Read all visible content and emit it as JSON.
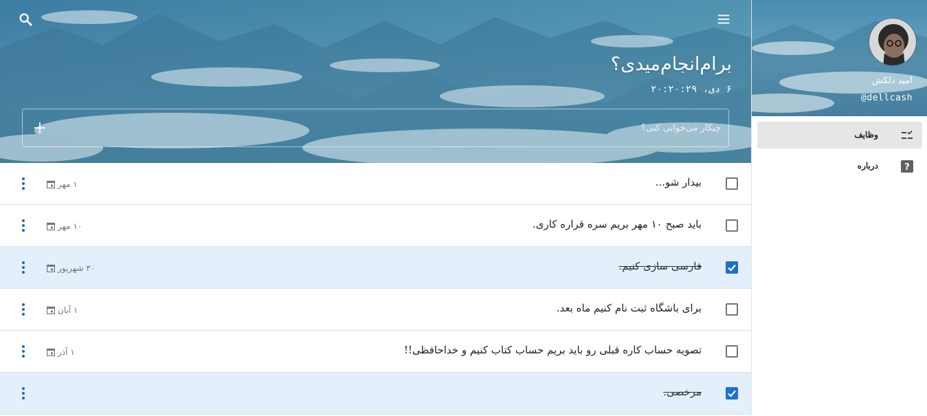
{
  "header": {
    "title": "برام‌انجام‌میدی؟",
    "datetime": "۶ دی، ۲۰:۲۰:۲۹",
    "search_icon": "search-icon",
    "menu_icon": "menu-icon"
  },
  "new_task": {
    "placeholder": "چیکار می‌خوایی کنی؟",
    "add_icon": "plus-icon"
  },
  "tasks": [
    {
      "text": "بیدار شو...",
      "due": "۱ مهر",
      "done": false
    },
    {
      "text": "باید صبح ۱۰ مهر بریم سره قراره کاری.",
      "due": "۱۰ مهر",
      "done": false
    },
    {
      "text": "فارسی سازی کنیم.",
      "due": "۳۰ شهریور",
      "done": true
    },
    {
      "text": "برای باشگاه ثبت نام کنیم ماه بعد.",
      "due": "۱ آبان",
      "done": false
    },
    {
      "text": "تصویه حساب کاره قبلی رو باید بریم حساب کتاب کنیم و خداحافظی!!",
      "due": "۱ آذر",
      "done": false
    },
    {
      "text": "مرخصی.",
      "due": "",
      "done": true
    }
  ],
  "sidebar": {
    "user_name": "امید دلکش",
    "user_handle": "@dellcash",
    "nav": [
      {
        "label": "وظایف",
        "icon": "checklist-icon",
        "active": true
      },
      {
        "label": "درباره",
        "icon": "help-icon",
        "active": false
      }
    ]
  },
  "colors": {
    "accent": "#1e6fd0",
    "done_row": "#e3f0fc",
    "kebab": "#1e68b4"
  }
}
